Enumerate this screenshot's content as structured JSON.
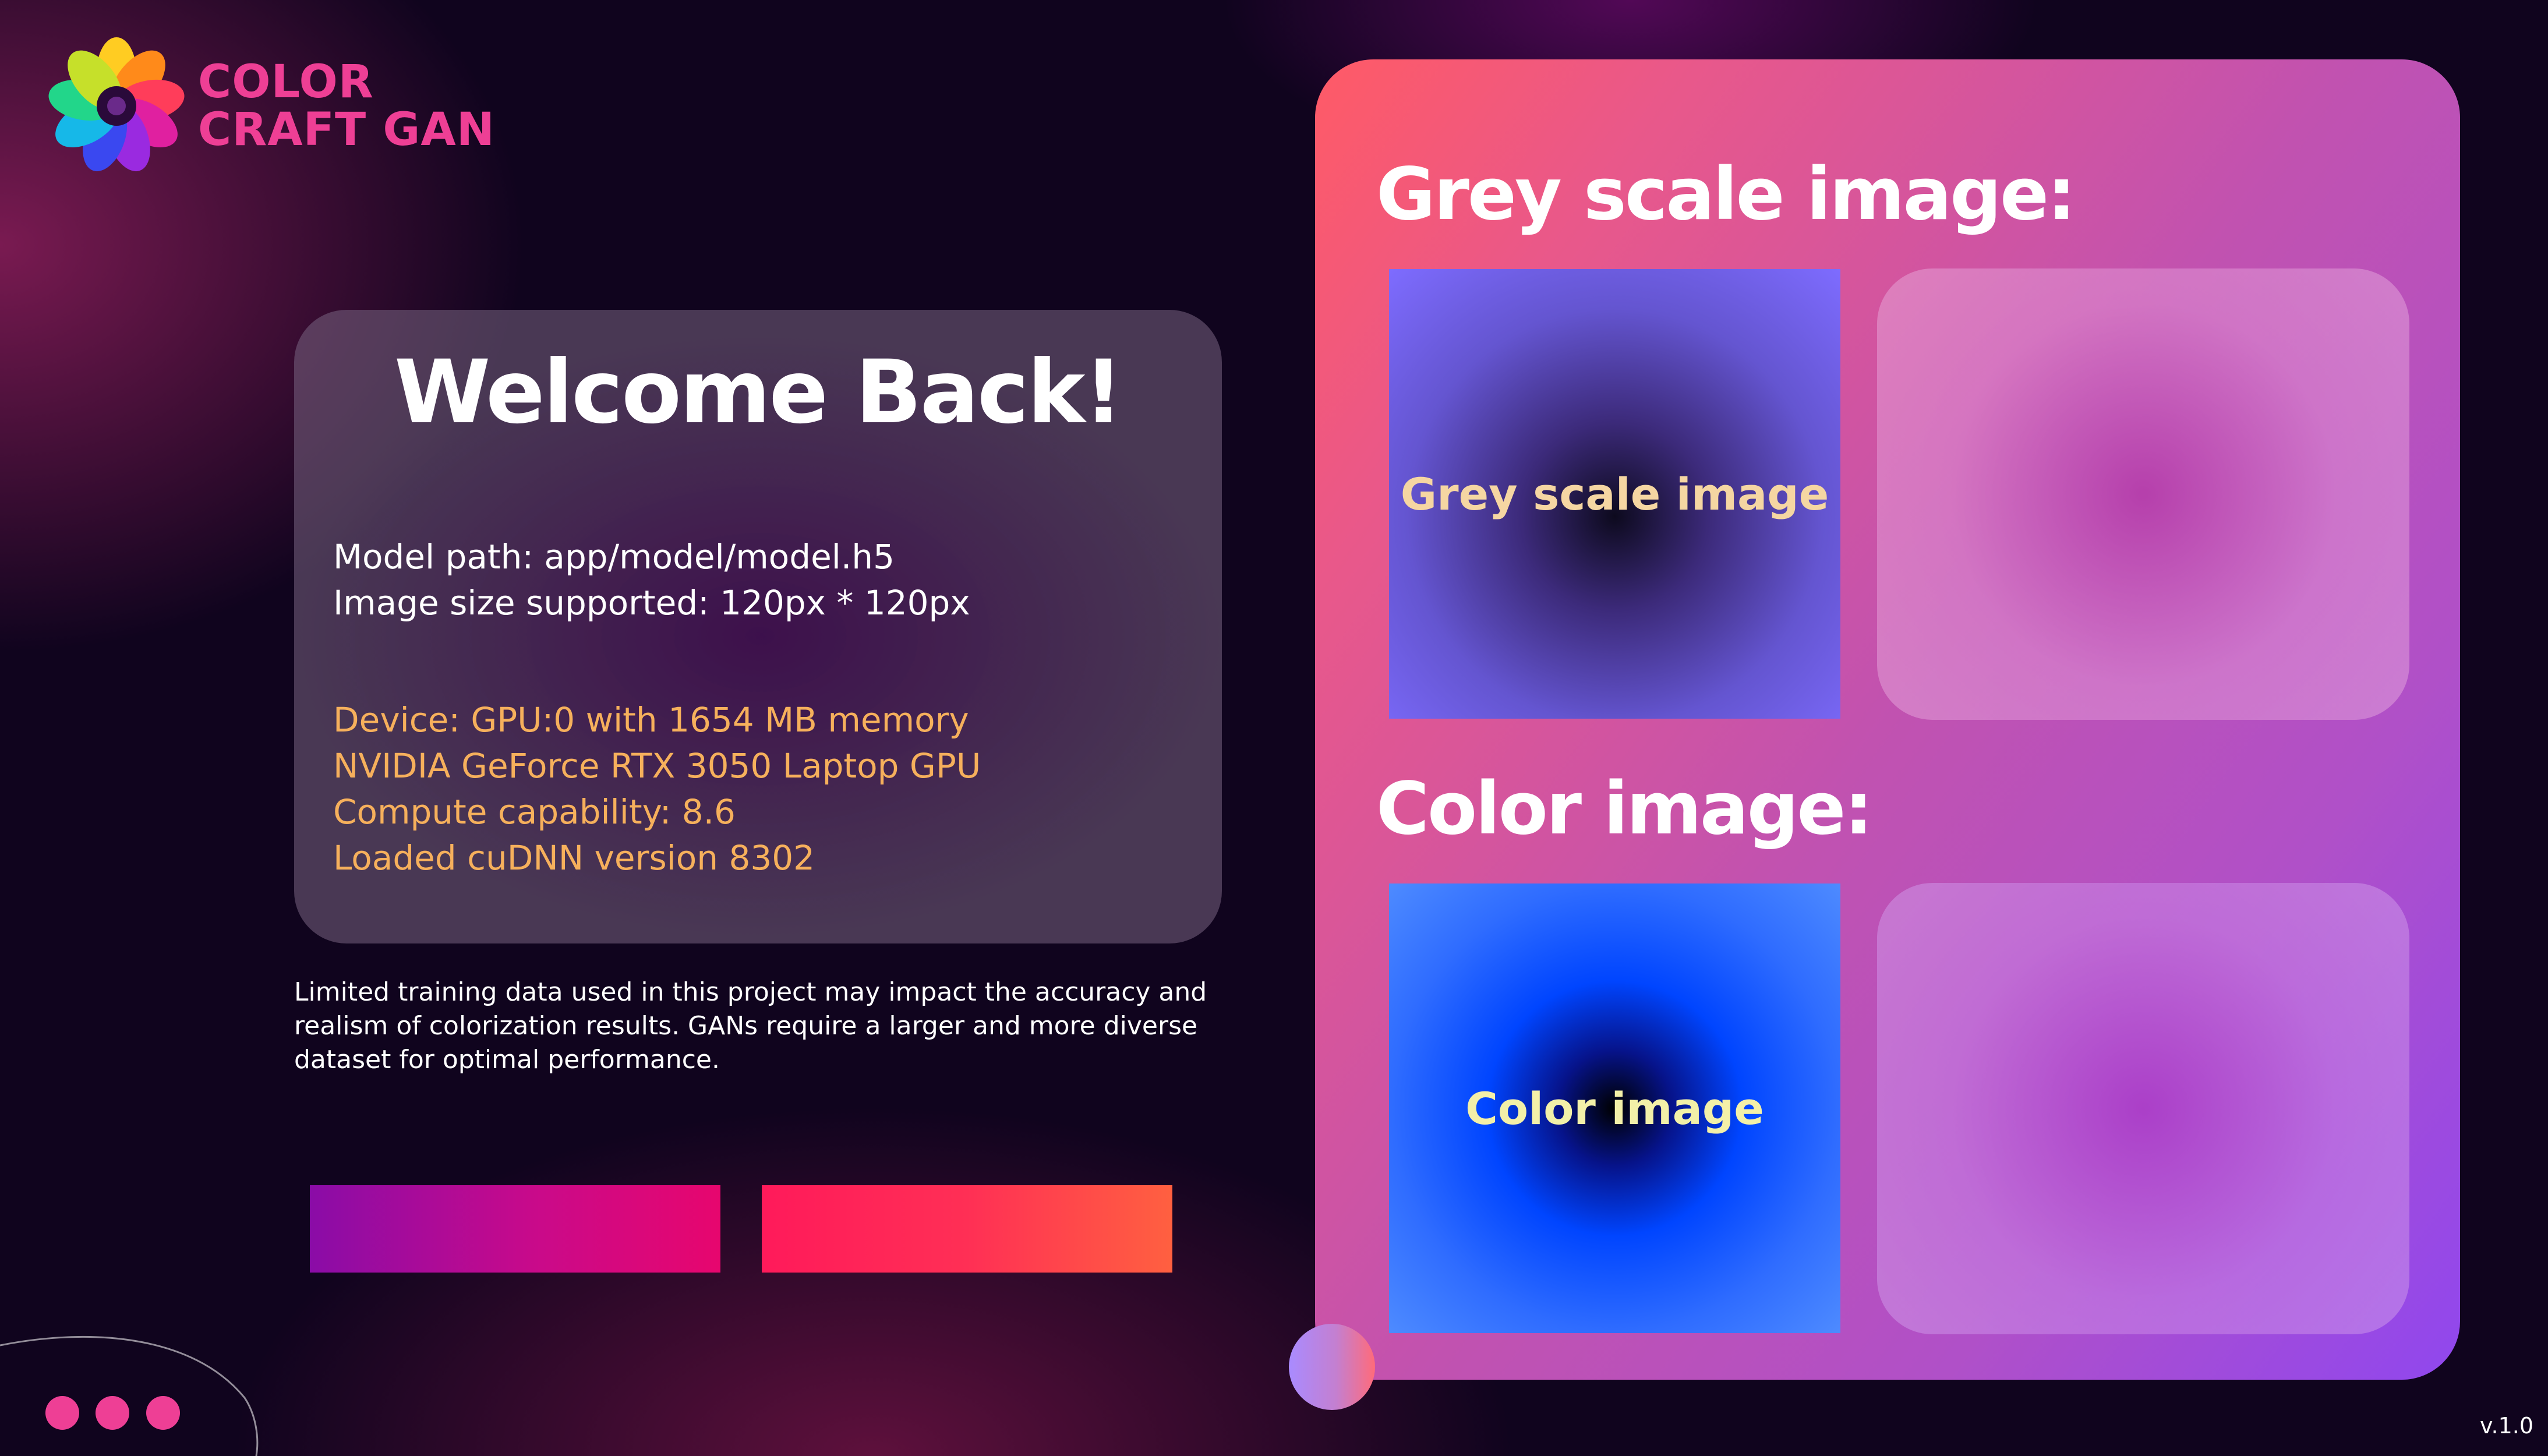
{
  "app": {
    "logo_line1": "COLOR",
    "logo_line2": "CRAFT GAN",
    "version": "v.1.0"
  },
  "welcome": {
    "title": "Welcome Back!",
    "model_path": "Model path: app/model/model.h5",
    "image_size": "Image size supported: 120px * 120px",
    "device": "Device: GPU:0 with 1654 MB memory",
    "gpu_name": "NVIDIA GeForce RTX 3050 Laptop GPU",
    "compute": "Compute capability: 8.6",
    "cudnn": "Loaded cuDNN version 8302"
  },
  "disclaimer": {
    "line1": "Limited training data used in this project may impact the accuracy and",
    "line2": "realism of colorization results. GANs require a larger and more diverse",
    "line3": "dataset for optimal performance."
  },
  "panel": {
    "grey_heading": "Grey scale image:",
    "grey_placeholder": "Grey scale image",
    "color_heading": "Color image:",
    "color_placeholder": "Color image"
  },
  "icons": [
    "logo-swirl-icon",
    "pager-dot-icon"
  ],
  "colors": {
    "accent_pink": "#ee3f95",
    "info_gold": "#f6b05c",
    "background": "#10041e"
  }
}
